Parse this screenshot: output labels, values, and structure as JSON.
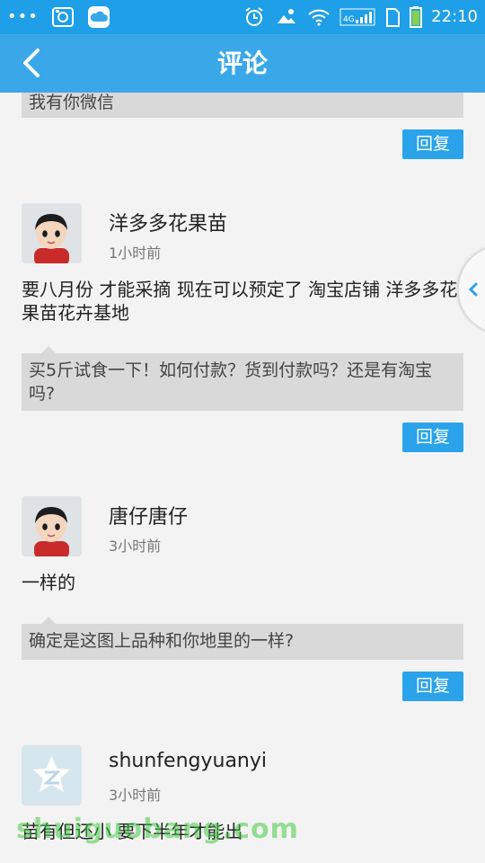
{
  "status_bar": {
    "dots": "•••",
    "network": "4G",
    "time": "22:10"
  },
  "header": {
    "title": "评论"
  },
  "partial_reply": {
    "text": "我有你微信",
    "button_label": "回复"
  },
  "comments": [
    {
      "username": "洋多多花果苗",
      "time": "1小时前",
      "text": "要八月份 才能采摘 现在可以预定了 淘宝店铺  洋多多花果苗花卉基地",
      "reply": "买5斤试食一下！如何付款？货到付款吗？还是有淘宝吗?",
      "button_label": "回复"
    },
    {
      "username": "唐仔唐仔",
      "time": "3小时前",
      "text": "一样的",
      "reply": "确定是这图上品种和你地里的一样?",
      "button_label": "回复"
    },
    {
      "username": "shunfengyuanyi",
      "time": "3小时前",
      "text": "苗有但还小 要下半年才能出"
    }
  ],
  "watermark": "shuiguobang.com",
  "colors": {
    "status_bar": "#1e9fe8",
    "header": "#3aa8e8",
    "reply_button": "#2aa3ea",
    "reply_box": "#d9d9d9",
    "background": "#f3f3f3"
  }
}
